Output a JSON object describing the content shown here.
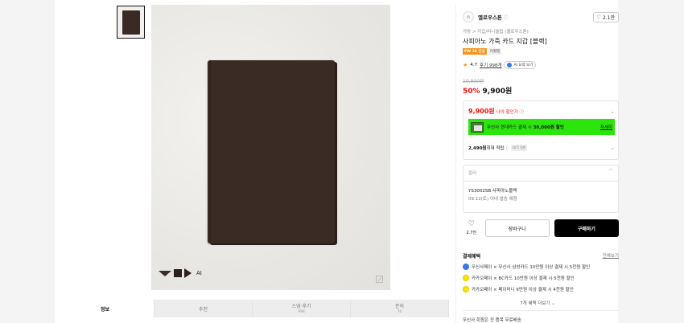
{
  "gallery": {
    "thumb_alt": "thumbnail-wallet",
    "ai_label": "AI",
    "ai_sub": "·"
  },
  "tabs": [
    {
      "label": "정보",
      "sub": ""
    },
    {
      "label": "추천",
      "sub": ""
    },
    {
      "label": "스냅·후기",
      "sub": "998"
    },
    {
      "label": "문의",
      "sub": "70"
    }
  ],
  "brand": {
    "logo_text": "∩",
    "name": "옐로우스톤",
    "info": "ⓘ",
    "like_count": "2.1만"
  },
  "product": {
    "breadcrumb": "가방 > 지갑/머니클립 (옐로우스톤)",
    "title": "사피아노 가죽 카드 지갑 [블랙]",
    "badge_fw": "FW 26 신상",
    "badge_gray": "이월템",
    "rating": "4.7",
    "review_text": "후기 998개",
    "ai_summary": "AI 요약 보기",
    "original_price": "19,800원",
    "discount": "50%",
    "sale_price": "9,900원"
  },
  "price_box": {
    "my_price": "9,900원",
    "my_price_label": "나의 할인가 ⓘ",
    "card_text_prefix": "무신사 현대카드 결제 시 ",
    "card_text_bold": "30,000원 할인",
    "apply_link": "자세히",
    "points": "2,490원",
    "points_label": " 최대 적립",
    "points_info": " ⓘ",
    "lv_badge": "LV.5 일반"
  },
  "option": {
    "color_label": "컬러",
    "option_name": "YS3002SB 사피아노블랙",
    "option_ship": "09.12(토) 이내 발송 예정"
  },
  "actions": {
    "wish_count": "2.7천",
    "cart_label": "장바구니",
    "buy_label": "구매하기"
  },
  "benefits": {
    "title": "결제혜택",
    "more": "전체보기",
    "items": [
      {
        "text": "무신사페이 × 무신사 삼성카드 10만원 이상 결제 시 5천원 할인",
        "color": "#2f7be8"
      },
      {
        "text": "카카오페이 × BC카드 10만원 이상 결제 시 5천원 할인",
        "color": "#ffe400"
      },
      {
        "text": "카카오페이 × 페이머니 6만원 이상 결제 시 4천원 할인",
        "color": "#ffe400"
      }
    ],
    "expand": "7개 혜택 더보기 ⌄"
  },
  "bottom_text": "무신사 회원은 전 품목 무료배송",
  "colors": {
    "accent_red": "#f31110",
    "banner_green": "#2be60c",
    "badge_orange": "#f7941d"
  }
}
